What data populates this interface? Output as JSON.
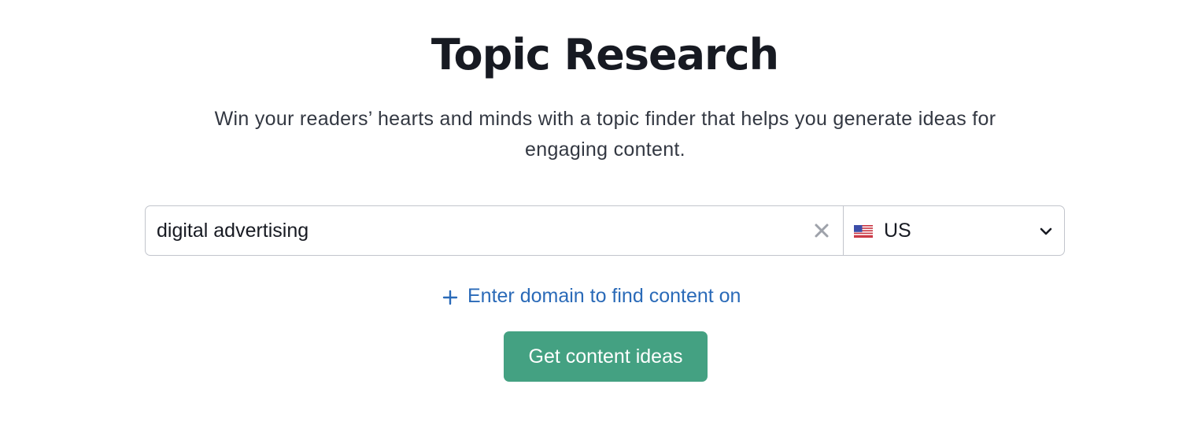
{
  "header": {
    "title": "Topic Research",
    "subtitle": "Win your readers’ hearts and minds with a topic finder that helps you generate ideas for engaging content."
  },
  "search": {
    "value": "digital advertising",
    "clear_icon": "close-icon"
  },
  "country": {
    "flag_icon": "us-flag-icon",
    "selected": "US",
    "dropdown_icon": "chevron-down-icon"
  },
  "domain_link": {
    "icon": "plus-icon",
    "label": "Enter domain to find content on"
  },
  "primary_button": {
    "label": "Get content ideas"
  },
  "colors": {
    "accent_button": "#44a182",
    "link": "#2a6ab8",
    "text": "#171a22",
    "border": "#c2c5cc"
  }
}
